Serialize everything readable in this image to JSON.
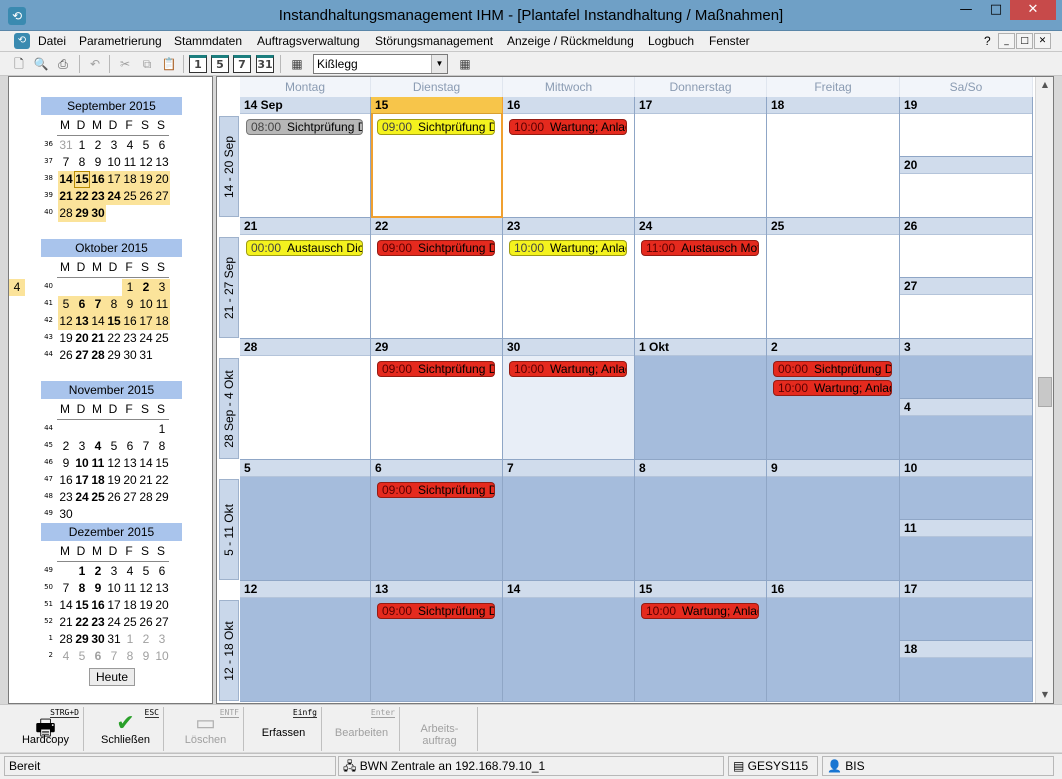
{
  "window": {
    "title": "Instandhaltungsmanagement IHM - [Plantafel Instandhaltung / Maßnahmen]",
    "min": "—",
    "max": "□",
    "close": "✕"
  },
  "menu": [
    "Datei",
    "Parametrierung",
    "Stammdaten",
    "Auftragsverwaltung",
    "Störungsmanagement",
    "Anzeige / Rückmeldung",
    "Logbuch",
    "Fenster"
  ],
  "menu_right": [
    "?",
    "_",
    "□",
    "✕"
  ],
  "toolbar": {
    "view_buttons": [
      "1",
      "5",
      "7",
      "31"
    ],
    "location": "Kißlegg"
  },
  "mini_calendars": [
    {
      "title": "September 2015",
      "dow": [
        "M",
        "D",
        "M",
        "D",
        "F",
        "S",
        "S"
      ],
      "weeks": [
        {
          "wk": "36",
          "days": [
            [
              "31",
              "g"
            ],
            [
              "1",
              ""
            ],
            [
              "2",
              ""
            ],
            [
              "3",
              ""
            ],
            [
              "4",
              ""
            ],
            [
              "5",
              ""
            ],
            [
              "6",
              ""
            ]
          ]
        },
        {
          "wk": "37",
          "days": [
            [
              "7",
              ""
            ],
            [
              "8",
              ""
            ],
            [
              "9",
              ""
            ],
            [
              "10",
              ""
            ],
            [
              "11",
              ""
            ],
            [
              "12",
              ""
            ],
            [
              "13",
              ""
            ]
          ]
        },
        {
          "wk": "38",
          "days": [
            [
              "14",
              "hl b"
            ],
            [
              "15",
              "hl b today"
            ],
            [
              "16",
              "hl b"
            ],
            [
              "17",
              "hl"
            ],
            [
              "18",
              "hl"
            ],
            [
              "19",
              "hl"
            ],
            [
              "20",
              "hl"
            ]
          ]
        },
        {
          "wk": "39",
          "days": [
            [
              "21",
              "hl b"
            ],
            [
              "22",
              "hl b"
            ],
            [
              "23",
              "hl b"
            ],
            [
              "24",
              "hl b"
            ],
            [
              "25",
              "hl"
            ],
            [
              "26",
              "hl"
            ],
            [
              "27",
              "hl"
            ]
          ]
        },
        {
          "wk": "40",
          "days": [
            [
              "28",
              "hl"
            ],
            [
              "29",
              "hl b"
            ],
            [
              "30",
              "hl b"
            ]
          ]
        }
      ]
    },
    {
      "title": "Oktober 2015",
      "dow": [
        "M",
        "D",
        "M",
        "D",
        "F",
        "S",
        "S"
      ],
      "weeks": [
        {
          "wk": "40",
          "offset": 4,
          "days": [
            [
              "1",
              "hl"
            ],
            [
              "2",
              "hl b"
            ],
            [
              "3",
              "hl"
            ],
            [
              "4",
              "hl"
            ]
          ]
        },
        {
          "wk": "41",
          "days": [
            [
              "5",
              "hl"
            ],
            [
              "6",
              "hl b"
            ],
            [
              "7",
              "hl b"
            ],
            [
              "8",
              "hl"
            ],
            [
              "9",
              "hl"
            ],
            [
              "10",
              "hl"
            ],
            [
              "11",
              "hl"
            ]
          ]
        },
        {
          "wk": "42",
          "days": [
            [
              "12",
              "hl"
            ],
            [
              "13",
              "hl b"
            ],
            [
              "14",
              "hl"
            ],
            [
              "15",
              "hl b"
            ],
            [
              "16",
              "hl"
            ],
            [
              "17",
              "hl"
            ],
            [
              "18",
              "hl"
            ]
          ]
        },
        {
          "wk": "43",
          "days": [
            [
              "19",
              ""
            ],
            [
              "20",
              "b"
            ],
            [
              "21",
              "b"
            ],
            [
              "22",
              ""
            ],
            [
              "23",
              ""
            ],
            [
              "24",
              ""
            ],
            [
              "25",
              ""
            ]
          ]
        },
        {
          "wk": "44",
          "days": [
            [
              "26",
              ""
            ],
            [
              "27",
              "b"
            ],
            [
              "28",
              "b"
            ],
            [
              "29",
              ""
            ],
            [
              "30",
              ""
            ],
            [
              "31",
              ""
            ]
          ]
        }
      ]
    },
    {
      "title": "November 2015",
      "dow": [
        "M",
        "D",
        "M",
        "D",
        "F",
        "S",
        "S"
      ],
      "weeks": [
        {
          "wk": "44",
          "offset": 6,
          "days": [
            [
              "1",
              ""
            ]
          ]
        },
        {
          "wk": "45",
          "days": [
            [
              "2",
              ""
            ],
            [
              "3",
              ""
            ],
            [
              "4",
              "b"
            ],
            [
              "5",
              ""
            ],
            [
              "6",
              ""
            ],
            [
              "7",
              ""
            ],
            [
              "8",
              ""
            ]
          ]
        },
        {
          "wk": "46",
          "days": [
            [
              "9",
              ""
            ],
            [
              "10",
              "b"
            ],
            [
              "11",
              "b"
            ],
            [
              "12",
              ""
            ],
            [
              "13",
              ""
            ],
            [
              "14",
              ""
            ],
            [
              "15",
              ""
            ]
          ]
        },
        {
          "wk": "47",
          "days": [
            [
              "16",
              ""
            ],
            [
              "17",
              "b"
            ],
            [
              "18",
              "b"
            ],
            [
              "19",
              ""
            ],
            [
              "20",
              ""
            ],
            [
              "21",
              ""
            ],
            [
              "22",
              ""
            ]
          ]
        },
        {
          "wk": "48",
          "days": [
            [
              "23",
              ""
            ],
            [
              "24",
              "b"
            ],
            [
              "25",
              "b"
            ],
            [
              "26",
              ""
            ],
            [
              "27",
              ""
            ],
            [
              "28",
              ""
            ],
            [
              "29",
              ""
            ]
          ]
        },
        {
          "wk": "49",
          "days": [
            [
              "30",
              ""
            ]
          ]
        }
      ]
    },
    {
      "title": "Dezember 2015",
      "dow": [
        "M",
        "D",
        "M",
        "D",
        "F",
        "S",
        "S"
      ],
      "weeks": [
        {
          "wk": "49",
          "offset": 1,
          "days": [
            [
              "1",
              "b"
            ],
            [
              "2",
              "b"
            ],
            [
              "3",
              ""
            ],
            [
              "4",
              ""
            ],
            [
              "5",
              ""
            ],
            [
              "6",
              ""
            ]
          ]
        },
        {
          "wk": "50",
          "days": [
            [
              "7",
              ""
            ],
            [
              "8",
              "b"
            ],
            [
              "9",
              "b"
            ],
            [
              "10",
              ""
            ],
            [
              "11",
              ""
            ],
            [
              "12",
              ""
            ],
            [
              "13",
              ""
            ]
          ]
        },
        {
          "wk": "51",
          "days": [
            [
              "14",
              ""
            ],
            [
              "15",
              "b"
            ],
            [
              "16",
              "b"
            ],
            [
              "17",
              ""
            ],
            [
              "18",
              ""
            ],
            [
              "19",
              ""
            ],
            [
              "20",
              ""
            ]
          ]
        },
        {
          "wk": "52",
          "days": [
            [
              "21",
              ""
            ],
            [
              "22",
              "b"
            ],
            [
              "23",
              "b"
            ],
            [
              "24",
              ""
            ],
            [
              "25",
              ""
            ],
            [
              "26",
              ""
            ],
            [
              "27",
              ""
            ]
          ]
        },
        {
          "wk": "1",
          "days": [
            [
              "28",
              ""
            ],
            [
              "29",
              "b"
            ],
            [
              "30",
              "b"
            ],
            [
              "31",
              ""
            ],
            [
              "1",
              "g"
            ],
            [
              "2",
              "g"
            ],
            [
              "3",
              "g"
            ]
          ]
        },
        {
          "wk": "2",
          "days": [
            [
              "4",
              "g"
            ],
            [
              "5",
              "g"
            ],
            [
              "6",
              "g b"
            ],
            [
              "7",
              "g"
            ],
            [
              "8",
              "g"
            ],
            [
              "9",
              "g"
            ],
            [
              "10",
              "g"
            ]
          ]
        }
      ]
    }
  ],
  "today_button": "Heute",
  "dow_headers": [
    "Montag",
    "Dienstag",
    "Mittwoch",
    "Donnerstag",
    "Freitag",
    "Sa/So"
  ],
  "weeks": [
    {
      "label": "14 - 20 Sep",
      "days": [
        {
          "label": "14 Sep",
          "state": "",
          "appts": [
            {
              "time": "08:00",
              "text": "Sichtprüfung Druck",
              "color": "gray"
            }
          ]
        },
        {
          "label": "15",
          "state": "sel",
          "appts": [
            {
              "time": "09:00",
              "text": "Sichtprüfung Druck",
              "color": "yellow"
            }
          ]
        },
        {
          "label": "16",
          "state": "",
          "appts": [
            {
              "time": "10:00",
              "text": "Wartung; Anlage",
              "color": "red"
            }
          ]
        },
        {
          "label": "17",
          "state": "",
          "appts": []
        },
        {
          "label": "18",
          "state": "",
          "appts": []
        }
      ],
      "sat": {
        "label": "19",
        "state": ""
      },
      "sun": {
        "label": "20",
        "state": ""
      }
    },
    {
      "label": "21 - 27 Sep",
      "days": [
        {
          "label": "21",
          "state": "",
          "appts": [
            {
              "time": "00:00",
              "text": "Austausch Dichtung",
              "color": "yellow"
            }
          ]
        },
        {
          "label": "22",
          "state": "",
          "appts": [
            {
              "time": "09:00",
              "text": "Sichtprüfung Druck",
              "color": "red"
            }
          ]
        },
        {
          "label": "23",
          "state": "",
          "appts": [
            {
              "time": "10:00",
              "text": "Wartung; Anlage",
              "color": "yellow"
            }
          ]
        },
        {
          "label": "24",
          "state": "",
          "appts": [
            {
              "time": "11:00",
              "text": "Austausch Motor",
              "color": "red"
            }
          ]
        },
        {
          "label": "25",
          "state": "",
          "appts": []
        }
      ],
      "sat": {
        "label": "26",
        "state": ""
      },
      "sun": {
        "label": "27",
        "state": ""
      }
    },
    {
      "label": "28 Sep - 4 Okt",
      "days": [
        {
          "label": "28",
          "state": "",
          "appts": []
        },
        {
          "label": "29",
          "state": "",
          "appts": [
            {
              "time": "09:00",
              "text": "Sichtprüfung Druck",
              "color": "red"
            }
          ]
        },
        {
          "label": "30",
          "state": "light",
          "appts": [
            {
              "time": "10:00",
              "text": "Wartung; Anlage",
              "color": "red"
            }
          ]
        },
        {
          "label": "1 Okt",
          "state": "shade",
          "appts": []
        },
        {
          "label": "2",
          "state": "shade",
          "appts": [
            {
              "time": "00:00",
              "text": "Sichtprüfung Druck",
              "color": "red"
            },
            {
              "time": "10:00",
              "text": "Wartung; Anlage",
              "color": "red"
            }
          ]
        }
      ],
      "sat": {
        "label": "3",
        "state": "shade"
      },
      "sun": {
        "label": "4",
        "state": "shade"
      }
    },
    {
      "label": "5 - 11 Okt",
      "days": [
        {
          "label": "5",
          "state": "shade",
          "appts": []
        },
        {
          "label": "6",
          "state": "shade",
          "appts": [
            {
              "time": "09:00",
              "text": "Sichtprüfung Druck",
              "color": "red"
            }
          ]
        },
        {
          "label": "7",
          "state": "shade",
          "appts": []
        },
        {
          "label": "8",
          "state": "shade",
          "appts": []
        },
        {
          "label": "9",
          "state": "shade",
          "appts": []
        }
      ],
      "sat": {
        "label": "10",
        "state": "shade"
      },
      "sun": {
        "label": "11",
        "state": "shade"
      }
    },
    {
      "label": "12 - 18 Okt",
      "days": [
        {
          "label": "12",
          "state": "shade",
          "appts": []
        },
        {
          "label": "13",
          "state": "shade",
          "appts": [
            {
              "time": "09:00",
              "text": "Sichtprüfung Druck",
              "color": "red"
            }
          ]
        },
        {
          "label": "14",
          "state": "shade",
          "appts": []
        },
        {
          "label": "15",
          "state": "shade",
          "appts": [
            {
              "time": "10:00",
              "text": "Wartung; Anlage",
              "color": "red"
            }
          ]
        },
        {
          "label": "16",
          "state": "shade",
          "appts": []
        }
      ],
      "sat": {
        "label": "17",
        "state": "shade"
      },
      "sun": {
        "label": "18",
        "state": "shade"
      }
    }
  ],
  "function_keys": [
    {
      "label": "Hardcopy",
      "hotkey": "STRG+D",
      "icon": "printer-icon",
      "glyph": "🖶",
      "enabled": true
    },
    {
      "label": "Schließen",
      "hotkey": "ESC",
      "icon": "checkmark-icon",
      "glyph": "✔",
      "enabled": true
    },
    {
      "label": "Löschen",
      "hotkey": "ENTF",
      "icon": "delete-icon",
      "glyph": "▭",
      "enabled": false
    },
    {
      "label": "Erfassen",
      "hotkey": "Einfg",
      "icon": "",
      "glyph": "",
      "enabled": true
    },
    {
      "label": "Bearbeiten",
      "hotkey": "Enter",
      "icon": "",
      "glyph": "",
      "enabled": false
    },
    {
      "label": "Arbeits-\nauftrag",
      "hotkey": "",
      "icon": "",
      "glyph": "",
      "enabled": false
    }
  ],
  "status": {
    "left": "Bereit",
    "connection": "BWN Zentrale an 192.168.79.10_1",
    "system": "GESYS115",
    "user": "BIS"
  },
  "colors": {
    "appt_red": "#e52a1e",
    "appt_yellow": "#f4f21e",
    "appt_gray": "#b7b7b7",
    "highlight": "#fbe39a",
    "shade": "#a5bcdc"
  }
}
